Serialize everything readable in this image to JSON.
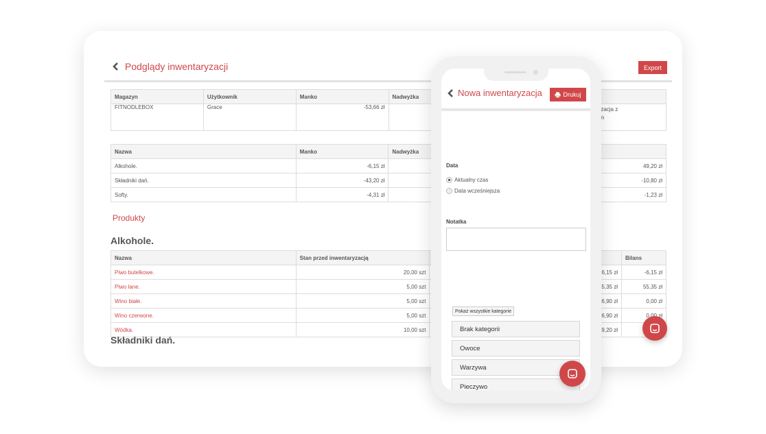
{
  "desktop": {
    "title": "Podglądy inwentaryzacji",
    "export_label": "Export",
    "summary": {
      "headers": [
        "Magazyn",
        "Użytkownik",
        "Manko",
        "Nadwyżka",
        "",
        ""
      ],
      "row": [
        "FITNODLEBOX",
        "Grace",
        "-53,66 zł",
        "",
        "",
        "inwentaryzacja z\nym stanem\nowym"
      ]
    },
    "categories_table": {
      "headers": [
        "Nazwa",
        "Manko",
        "Nadwyżka",
        "",
        ""
      ],
      "rows": [
        [
          "Alkohole.",
          "-6,15 zł",
          "",
          "",
          "49,20 zł"
        ],
        [
          "Składniki dań.",
          "-43,20 zł",
          "",
          "",
          "-10,80 zł"
        ],
        [
          "Softy.",
          "-4,31 zł",
          "",
          "",
          "-1,23 zł"
        ]
      ]
    },
    "products_heading": "Produkty",
    "group1_title": "Alkohole.",
    "products_table": {
      "headers": [
        "Nazwa",
        "Stan przed inwentaryzacją",
        "",
        "",
        "Bilans"
      ],
      "rows": [
        [
          "Piwo butelkowe.",
          "20,00 szt",
          "",
          "6,15 zł",
          "-6,15 zł"
        ],
        [
          "Piwo lane.",
          "5,00 szt",
          "",
          "55,35 zł",
          "55,35 zł"
        ],
        [
          "Wino białe.",
          "5,00 szt",
          "",
          "36,90 zł",
          "0,00 zł"
        ],
        [
          "Wino czerwone.",
          "5,00 szt",
          "",
          "36,90 zł",
          "0,00 zł"
        ],
        [
          "Wódka.",
          "10,00 szt",
          "",
          "49,20 zł",
          "0,00 zł"
        ]
      ]
    },
    "group2_title": "Składniki dań."
  },
  "mobile": {
    "title": "Nowa inwentaryzacja",
    "print_label": "Drukuj",
    "date_label": "Data",
    "radio_current": "Aktualny czas",
    "radio_earlier": "Data wcześniejsza",
    "note_label": "Notatka",
    "show_all_label": "Pokaż wszystkie kategorie",
    "categories": [
      "Brak kategorii",
      "Owoce",
      "Warzywa",
      "Pieczywo"
    ]
  },
  "colors": {
    "accent": "#d0474a",
    "border": "#dcdcdc",
    "header_bg": "#f4f4f4"
  },
  "icons": [
    "chevron-left-icon",
    "printer-icon",
    "chat-icon"
  ]
}
